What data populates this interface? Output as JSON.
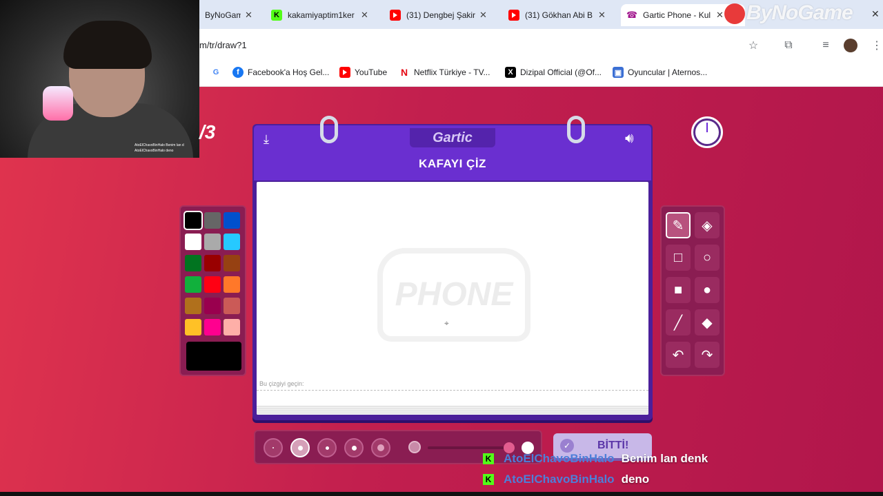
{
  "browser": {
    "tabs": [
      {
        "label": "ByNoGam",
        "icon": "bynogame-icon",
        "type": "plain"
      },
      {
        "label": "kakamiyaptim1ker",
        "icon": "kick-icon",
        "type": "kick"
      },
      {
        "label": "(31) Dengbej Şakir",
        "icon": "youtube-icon",
        "type": "yt"
      },
      {
        "label": "(31) Gökhan Abi B",
        "icon": "youtube-icon",
        "type": "yt"
      },
      {
        "label": "Gartic Phone - Kul",
        "icon": "gartic-icon",
        "type": "active"
      }
    ],
    "url": "m/tr/draw?1",
    "bookmarks": [
      {
        "label": "",
        "icon": "google-icon"
      },
      {
        "label": "Facebook'a Hoş Gel...",
        "icon": "facebook-icon"
      },
      {
        "label": "YouTube",
        "icon": "youtube-icon"
      },
      {
        "label": "Netflix Türkiye - TV...",
        "icon": "netflix-icon"
      },
      {
        "label": "Dizipal Official (@Of...",
        "icon": "x-icon"
      },
      {
        "label": "Oyuncular | Aternos...",
        "icon": "aternos-icon"
      }
    ]
  },
  "overlay": {
    "watermark": "ByNoGame",
    "webcam_chat": [
      "AtoElChavoBinHalo Benim lan d",
      "AtoElChavoBinHalo deno"
    ]
  },
  "game": {
    "round": "/3",
    "logo": "Gartic",
    "title": "KAFAYI ÇİZ",
    "canvas_watermark": "PHONE",
    "hint": "Bu çizgiyi geçin:",
    "done_label": "BİTTİ!",
    "timer_level": 0.02,
    "selected_color": "#000000",
    "selected_tool": "pencil",
    "selected_size_index": 1,
    "palette": [
      "#000000",
      "#666666",
      "#0050cd",
      "#ffffff",
      "#aaaaaa",
      "#26c9ff",
      "#017420",
      "#990000",
      "#964112",
      "#11b03c",
      "#ff0013",
      "#ff7829",
      "#b0701c",
      "#99004e",
      "#cb5a57",
      "#ffc126",
      "#ff008f",
      "#feafa8"
    ],
    "tools": [
      {
        "name": "pencil",
        "icon": "pencil-icon",
        "glyph": "✎"
      },
      {
        "name": "eraser",
        "icon": "eraser-icon",
        "glyph": "◈"
      },
      {
        "name": "rectangle-outline",
        "icon": "square-outline-icon",
        "glyph": "□"
      },
      {
        "name": "ellipse-outline",
        "icon": "circle-outline-icon",
        "glyph": "○"
      },
      {
        "name": "rectangle-fill",
        "icon": "square-fill-icon",
        "glyph": "■"
      },
      {
        "name": "ellipse-fill",
        "icon": "circle-fill-icon",
        "glyph": "●"
      },
      {
        "name": "line",
        "icon": "line-icon",
        "glyph": "╱"
      },
      {
        "name": "fill",
        "icon": "bucket-icon",
        "glyph": "◆"
      },
      {
        "name": "undo",
        "icon": "undo-icon",
        "glyph": "↶"
      },
      {
        "name": "redo",
        "icon": "redo-icon",
        "glyph": "↷"
      }
    ]
  },
  "stream_chat": [
    {
      "platform": "kick-icon",
      "user": "AtoElChavoBinHalo",
      "message": "Benim lan denk"
    },
    {
      "platform": "kick-icon",
      "user": "AtoElChavoBinHalo",
      "message": "deno"
    }
  ]
}
